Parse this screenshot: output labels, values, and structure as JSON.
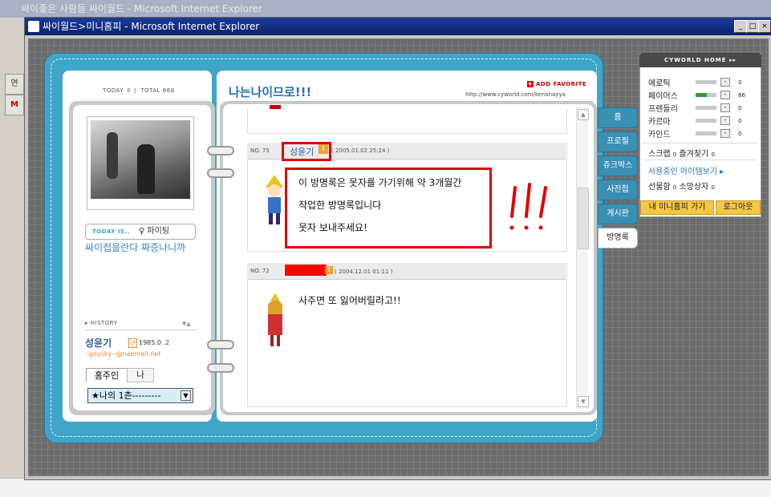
{
  "background_window": {
    "title": "싸이좋은 사람들 싸이월드 - Microsoft Internet Explorer",
    "left_labels": [
      "연",
      "M"
    ]
  },
  "popup": {
    "title": "싸이월드>미니홈피 - Microsoft Internet Explorer"
  },
  "left": {
    "today_label": "TODAY",
    "today_count": "6",
    "total_label": "TOTAL",
    "total_count": "668",
    "today_is_label": "TODAY IS..",
    "today_is_value": "파이팅",
    "mood_text": "싸이접을란다 짜증나니까",
    "history_label": "HISTORY",
    "owner_name": "성윤기",
    "owner_gender": "♂",
    "owner_birth": "1985.0 .2",
    "owner_email": "--psysky--@naemail.net",
    "tab_owner": "홈주인",
    "tab_me": "나",
    "ilchon_select": "★나의 1촌---------"
  },
  "header": {
    "title": "나는나이므로!!!",
    "add_favorite": "ADD FAVORITE",
    "url": "http://www.cyworld.com/kerisnayya"
  },
  "guestbook": [
    {
      "no": "NO. 75",
      "name": "성윤기",
      "date": "( 2005.01.02 25:24 )",
      "lines": [
        "이 방명록은 못자를 가기위해 약 3개월간",
        "작업한 방명록입니다",
        "못자 보내주세요!"
      ]
    },
    {
      "no": "NO. 72",
      "date": "( 2004.12.01 01:11 )",
      "lines": [
        "사주면 또 잃어버릴라고!!"
      ]
    }
  ],
  "annotation_text": "!!!",
  "side_tabs": [
    "홈",
    "프로필",
    "쥬크박스",
    "사진첩",
    "게시판",
    "방명록"
  ],
  "cyworld_home": {
    "header": "CYWORLD HOME",
    "stats": [
      {
        "label": "에로틱",
        "value": "0",
        "level": 0
      },
      {
        "label": "페이머스",
        "value": "86",
        "level": 0.55
      },
      {
        "label": "프렌들리",
        "value": "0",
        "level": 0
      },
      {
        "label": "카르마",
        "value": "0",
        "level": 0
      },
      {
        "label": "카인드",
        "value": "0",
        "level": 0
      }
    ],
    "scrap_label": "스크랩",
    "scrap_count": "0",
    "favorites_label": "즐겨찾기",
    "favorites_count": "0",
    "item_view_link": "사용중인 아이템보기",
    "gift_label": "선물함",
    "gift_count": "0",
    "wish_label": "소망상자",
    "wish_count": "0",
    "my_minihome_button": "내 미니홈피 가기",
    "logout_button": "로그아웃"
  },
  "colors": {
    "diary_blue": "#3fa6c8",
    "link_blue": "#2a6fb8",
    "annotation_red": "#e00000",
    "home_button_yellow": "#f5c842"
  }
}
